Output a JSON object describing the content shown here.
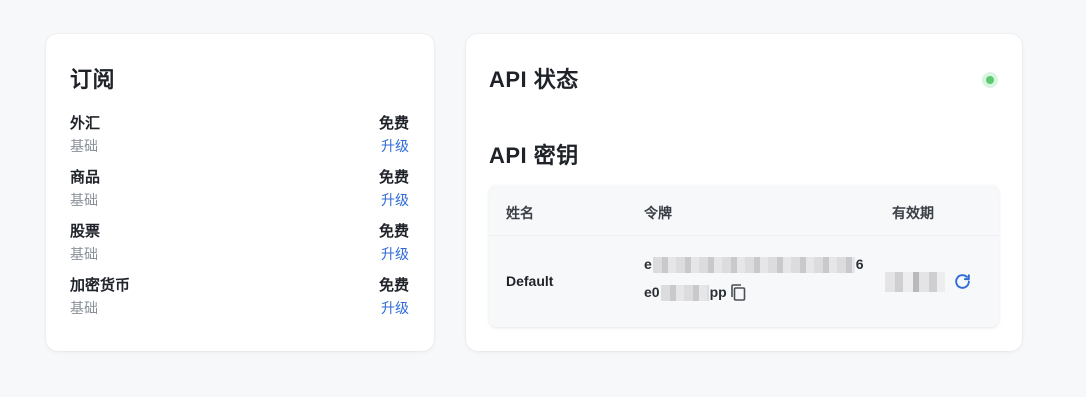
{
  "subscription": {
    "title": "订阅",
    "items": [
      {
        "name": "外汇",
        "tier": "基础",
        "plan": "免费",
        "upgrade": "升级"
      },
      {
        "name": "商品",
        "tier": "基础",
        "plan": "免费",
        "upgrade": "升级"
      },
      {
        "name": "股票",
        "tier": "基础",
        "plan": "免费",
        "upgrade": "升级"
      },
      {
        "name": "加密货币",
        "tier": "基础",
        "plan": "免费",
        "upgrade": "升级"
      }
    ]
  },
  "api": {
    "status_title": "API 状态",
    "status_color": "#5cc86f",
    "keys_title": "API 密钥",
    "table": {
      "headers": {
        "name": "姓名",
        "token": "令牌",
        "expiry": "有效期"
      },
      "rows": [
        {
          "name": "Default",
          "token_line1_start": "e",
          "token_line1_end": "6",
          "token_line2_start": "e0",
          "token_line2_end": "pp",
          "copy_icon": "copy-icon",
          "refresh_icon": "refresh-icon"
        }
      ]
    }
  },
  "colors": {
    "accent": "#2f6bd8",
    "background": "#f7f8fa",
    "card": "#ffffff"
  }
}
